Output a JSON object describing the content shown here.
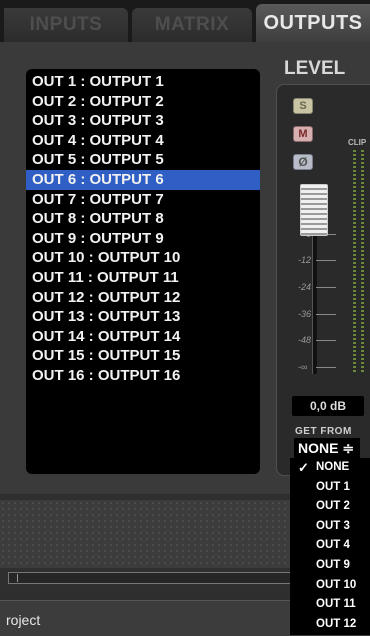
{
  "tabs": [
    {
      "label": "INPUTS"
    },
    {
      "label": "MATRIX"
    },
    {
      "label": "OUTPUTS"
    }
  ],
  "outputs": [
    "OUT 1 : OUTPUT 1",
    "OUT 2 : OUTPUT 2",
    "OUT 3 : OUTPUT 3",
    "OUT 4 : OUTPUT 4",
    "OUT 5 : OUTPUT 5",
    "OUT 6 : OUTPUT 6",
    "OUT 7 : OUTPUT 7",
    "OUT 8 : OUTPUT 8",
    "OUT 9 : OUTPUT 9",
    "OUT 10 : OUTPUT 10",
    "OUT 11 : OUTPUT 11",
    "OUT 12 : OUTPUT 12",
    "OUT 13 : OUTPUT 13",
    "OUT 14 : OUTPUT 14",
    "OUT 15 : OUTPUT 15",
    "OUT 16 : OUTPUT 16"
  ],
  "selected_output": "OUT 6 : OUTPUT 6",
  "level": {
    "title": "LEVEL",
    "solo_label": "S",
    "mute_label": "M",
    "phase_label": "Ø",
    "clip_label": "CLIP",
    "scale": [
      "0",
      "-6",
      "-12",
      "-24",
      "-36",
      "-48",
      "-∞"
    ],
    "value": "0,0 dB"
  },
  "get_from": {
    "label": "GET FROM",
    "selected": "NONE ≑",
    "options": [
      "NONE",
      "OUT 1",
      "OUT 2",
      "OUT 3",
      "OUT 4",
      "OUT 9",
      "OUT 10",
      "OUT 11",
      "OUT 12"
    ],
    "checked": "NONE"
  },
  "status_text": "roject",
  "colors": {
    "selection": "#2f5fc4",
    "background": "#3a3a3a"
  }
}
